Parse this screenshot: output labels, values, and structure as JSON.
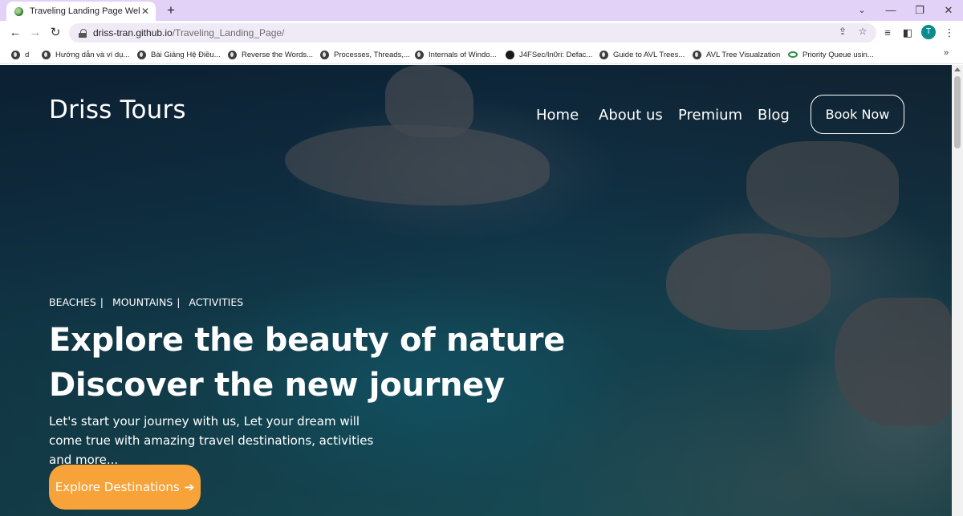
{
  "browser": {
    "tab_title": "Traveling Landing Page Web",
    "tab_close": "✕",
    "new_tab": "+",
    "url_host": "driss-tran.github.io",
    "url_path": "/Traveling_Landing_Page/",
    "profile_initial": "T",
    "window_controls": {
      "minimize": "—",
      "maximize": "❐",
      "close": "✕"
    },
    "nav": {
      "back": "←",
      "forward": "→",
      "reload": "↻"
    },
    "tab_color": "#e3d2f7",
    "omnibox_color": "#efeaf6"
  },
  "bookmarks": [
    {
      "label": "d",
      "icon": "globe-icon"
    },
    {
      "label": "Hướng dẫn và ví dụ...",
      "icon": "globe-icon"
    },
    {
      "label": "Bài Giảng Hệ Điều...",
      "icon": "globe-icon"
    },
    {
      "label": "Reverse the Words...",
      "icon": "globe-icon"
    },
    {
      "label": "Processes, Threads,...",
      "icon": "globe-icon"
    },
    {
      "label": "Internals of Windo...",
      "icon": "globe-icon"
    },
    {
      "label": "J4FSec/In0ri: Defac...",
      "icon": "github-icon"
    },
    {
      "label": "Guide to AVL Trees...",
      "icon": "globe-icon"
    },
    {
      "label": "AVL Tree Visualzation",
      "icon": "globe-icon"
    },
    {
      "label": "Priority Queue usin...",
      "icon": "geeksforgeeks-icon"
    }
  ],
  "bookmarks_more": "»",
  "site": {
    "brand": "Driss Tours",
    "nav": [
      "Home",
      "About us",
      "Premium",
      "Blog"
    ],
    "book_now": "Book Now",
    "tags": [
      "BEACHES |",
      "MOUNTAINS |",
      "ACTIVITIES"
    ],
    "headline_1": "Explore the beauty of nature",
    "headline_2": "Discover the new journey",
    "lede": "Let's start your journey with us, Let your dream will come true with amazing travel destinations, activities and more...",
    "cta_label": "Explore Destinations",
    "cta_arrow": "➔",
    "cta_color": "#f7a33a"
  }
}
